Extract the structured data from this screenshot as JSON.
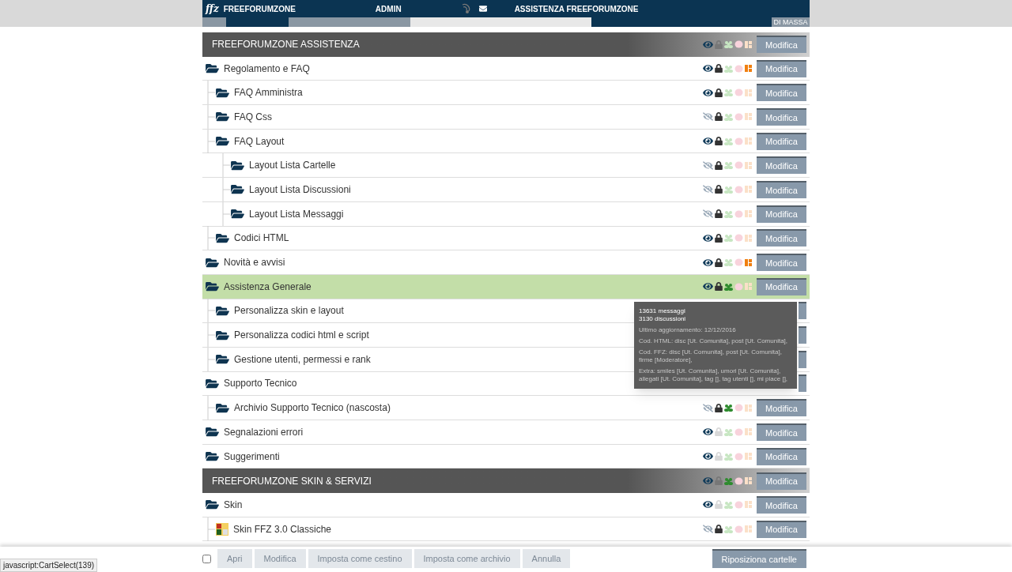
{
  "topbar": {
    "logo": "ffz",
    "site": "FREEFORUMZONE",
    "admin": "ADMIN",
    "forum": "ASSISTENZA FREEFORUMZONE",
    "tab_fragment": "DI MASSA"
  },
  "categories": [
    {
      "title": "FREEFORUMZONE ASSISTENZA",
      "status": {
        "visible": true,
        "locked": false,
        "group": false,
        "extra": false
      },
      "button": "Modifica",
      "folders": [
        {
          "kind": "folder",
          "name": "Regolamento e FAQ",
          "selected": false,
          "status": {
            "visible": true,
            "locked": true,
            "group": false,
            "extra": true
          },
          "button": "Modifica",
          "children": [
            {
              "kind": "folder",
              "name": "FAQ Amministra",
              "selected": false,
              "status": {
                "visible": true,
                "locked": true,
                "group": false,
                "extra": false
              },
              "button": "Modifica"
            },
            {
              "kind": "folder",
              "name": "FAQ Css",
              "selected": false,
              "status": {
                "visible": false,
                "locked": true,
                "group": false,
                "extra": false
              },
              "button": "Modifica"
            },
            {
              "kind": "folder",
              "name": "FAQ Layout",
              "selected": false,
              "status": {
                "visible": true,
                "locked": true,
                "group": false,
                "extra": false
              },
              "button": "Modifica",
              "children": [
                {
                  "kind": "folder",
                  "name": "Layout Lista Cartelle",
                  "selected": false,
                  "status": {
                    "visible": false,
                    "locked": true,
                    "group": false,
                    "extra": false
                  },
                  "button": "Modifica"
                },
                {
                  "kind": "folder",
                  "name": "Layout Lista Discussioni",
                  "selected": false,
                  "status": {
                    "visible": false,
                    "locked": true,
                    "group": false,
                    "extra": false
                  },
                  "button": "Modifica"
                },
                {
                  "kind": "folder",
                  "name": "Layout Lista Messaggi",
                  "selected": false,
                  "status": {
                    "visible": false,
                    "locked": true,
                    "group": false,
                    "extra": false
                  },
                  "button": "Modifica"
                }
              ]
            },
            {
              "kind": "folder",
              "name": "Codici HTML",
              "selected": false,
              "status": {
                "visible": true,
                "locked": true,
                "group": false,
                "extra": false
              },
              "button": "Modifica"
            }
          ]
        },
        {
          "kind": "folder",
          "name": "Novità e avvisi",
          "selected": false,
          "status": {
            "visible": true,
            "locked": true,
            "group": false,
            "extra": true
          },
          "button": "Modifica"
        },
        {
          "kind": "folder",
          "name": "Assistenza Generale",
          "selected": true,
          "status": {
            "visible": true,
            "locked": true,
            "group": true,
            "extra": false
          },
          "button": "Modifica",
          "children": [
            {
              "kind": "folder",
              "name": "Personalizza skin e layout",
              "selected": false
            },
            {
              "kind": "folder",
              "name": "Personalizza codici html e script",
              "selected": false
            },
            {
              "kind": "folder",
              "name": "Gestione utenti, permessi e rank",
              "selected": false
            }
          ]
        },
        {
          "kind": "folder",
          "name": "Supporto Tecnico",
          "selected": false,
          "children": [
            {
              "kind": "folder",
              "name": "Archivio Supporto Tecnico (nascosta)",
              "selected": false,
              "status": {
                "visible": false,
                "locked": true,
                "group": true,
                "extra": false
              },
              "button": "Modifica"
            }
          ]
        },
        {
          "kind": "folder",
          "name": "Segnalazioni errori",
          "selected": false,
          "status": {
            "visible": true,
            "locked": false,
            "group": false,
            "extra": false
          },
          "button": "Modifica"
        },
        {
          "kind": "folder",
          "name": "Suggerimenti",
          "selected": false,
          "status": {
            "visible": true,
            "locked": false,
            "group": false,
            "extra": false
          },
          "button": "Modifica"
        }
      ]
    },
    {
      "title": "FREEFORUMZONE SKIN & SERVIZI",
      "status": {
        "visible": true,
        "locked": false,
        "group": true,
        "extra": false
      },
      "button": "Modifica",
      "folders": [
        {
          "kind": "folder",
          "name": "Skin",
          "selected": false,
          "status": {
            "visible": true,
            "locked": false,
            "group": false,
            "extra": false
          },
          "button": "Modifica",
          "children": [
            {
              "kind": "skin",
              "name": "Skin FFZ 3.0 Classiche",
              "selected": false,
              "status": {
                "visible": false,
                "locked": true,
                "group": false,
                "extra": false
              },
              "button": "Modifica"
            }
          ]
        }
      ]
    }
  ],
  "tooltip": {
    "counts": [
      "13631 messaggi",
      "3130 discussioni"
    ],
    "details": [
      "Ultimo aggiornamento: 12/12/2016",
      "Cod. HTML: disc [Ut. Comunita], post [Ut. Comunita],",
      "Cod. FFZ: disc [Ut. Comunita], post [Ut. Comunita], firme [Moderatore],",
      "Extra: smiles [Ut. Comunita], umori [Ut. Comunita], allegati [Ut. Comunita], tag [], tag utenti [], mi piace [],"
    ]
  },
  "bottombar": {
    "checked": false,
    "actions": [
      {
        "label": "Apri",
        "disabled": true
      },
      {
        "label": "Modifica",
        "disabled": true
      },
      {
        "label": "Imposta come cestino",
        "disabled": true
      },
      {
        "label": "Imposta come archivio",
        "disabled": true
      },
      {
        "label": "Annulla",
        "disabled": true
      }
    ],
    "reposition": "Riposiziona cartelle"
  },
  "status_url": "javascript:CartSelect(139)"
}
